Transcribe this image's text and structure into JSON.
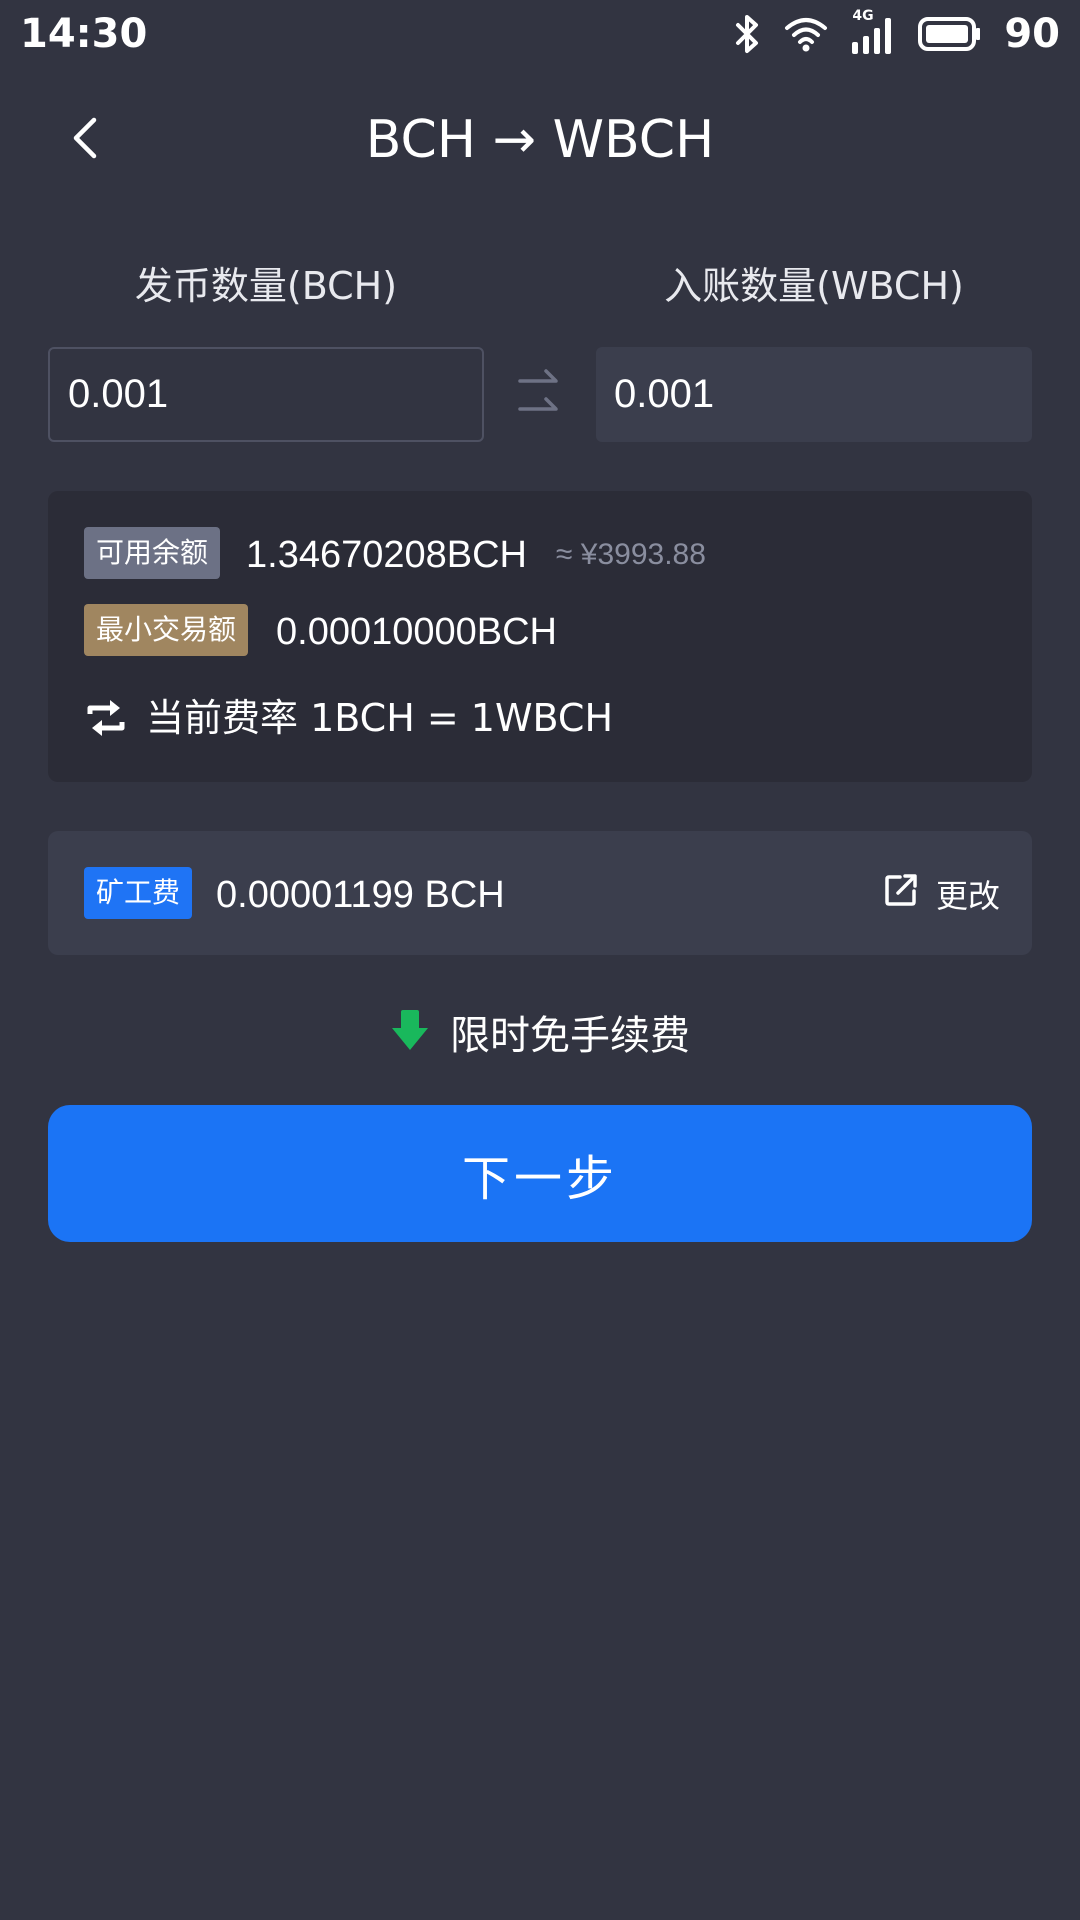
{
  "status_bar": {
    "time": "14:30",
    "network": "4G",
    "battery": "90",
    "icons": [
      "bluetooth-icon",
      "wifi-icon",
      "cellular-4g-icon",
      "battery-icon"
    ]
  },
  "header": {
    "title": "BCH → WBCH",
    "back_icon": "chevron-left-icon"
  },
  "exchange": {
    "send_label": "发币数量(BCH)",
    "receive_label": "入账数量(WBCH)",
    "send_value": "0.001",
    "receive_value": "0.001",
    "swap_icon": "swap-arrows-icon"
  },
  "info": {
    "balance_tag": "可用余额",
    "balance_value": "1.34670208BCH",
    "balance_approx": "≈ ¥3993.88",
    "min_tag": "最小交易额",
    "min_value": "0.00010000BCH",
    "rate_icon": "exchange-rate-icon",
    "rate_text": "当前费率 1BCH = 1WBCH"
  },
  "miner_fee": {
    "tag": "矿工费",
    "value": "0.00001199 BCH",
    "edit_label": "更改",
    "edit_icon": "edit-icon"
  },
  "promo": {
    "icon": "arrow-down-icon",
    "text": "限时免手续费"
  },
  "actions": {
    "next_label": "下一步"
  },
  "colors": {
    "background": "#323441",
    "card": "#2b2c37",
    "accent": "#1b74f5",
    "promo_arrow": "#19b85c",
    "tag_balance": "#6c7185",
    "tag_min": "#a08660"
  }
}
